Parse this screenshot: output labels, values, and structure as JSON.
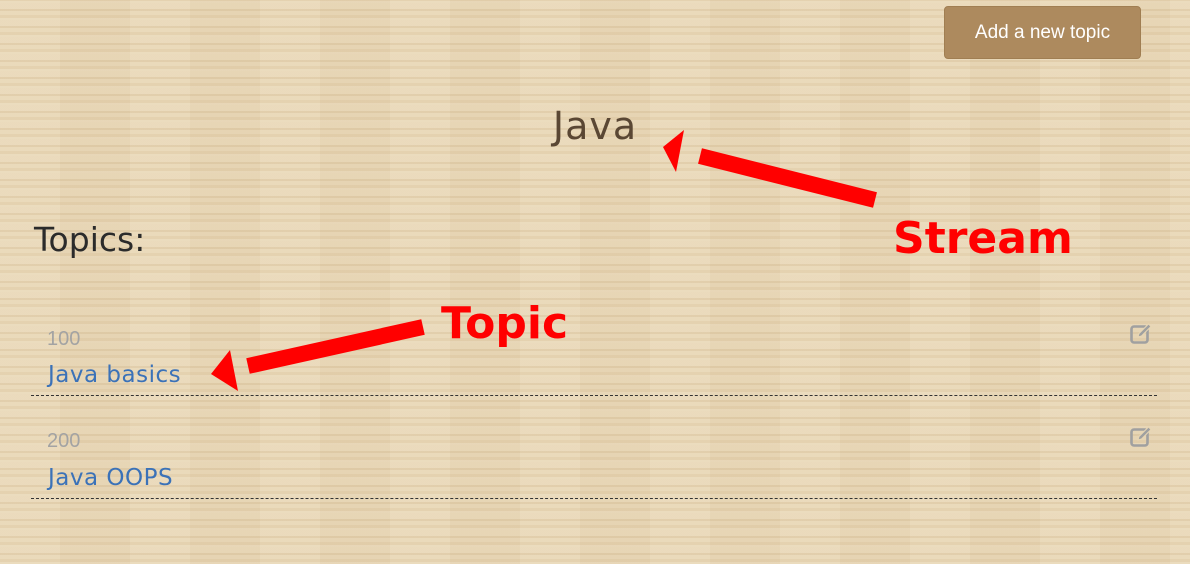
{
  "toolbar": {
    "add_topic_label": "Add a new topic"
  },
  "stream": {
    "title": "Java"
  },
  "topics": {
    "heading": "Topics:",
    "items": [
      {
        "number": "100",
        "name": "Java basics",
        "action_icon": "edit-icon"
      },
      {
        "number": "200",
        "name": "Java OOPS",
        "action_icon": "edit-icon"
      }
    ]
  },
  "annotations": {
    "stream_label": "Stream",
    "topic_label": "Topic",
    "color": "#ff0000"
  },
  "colors": {
    "button_bg": "#ad8a5e",
    "link": "#3b72b8",
    "background": "#e8d6b4"
  }
}
